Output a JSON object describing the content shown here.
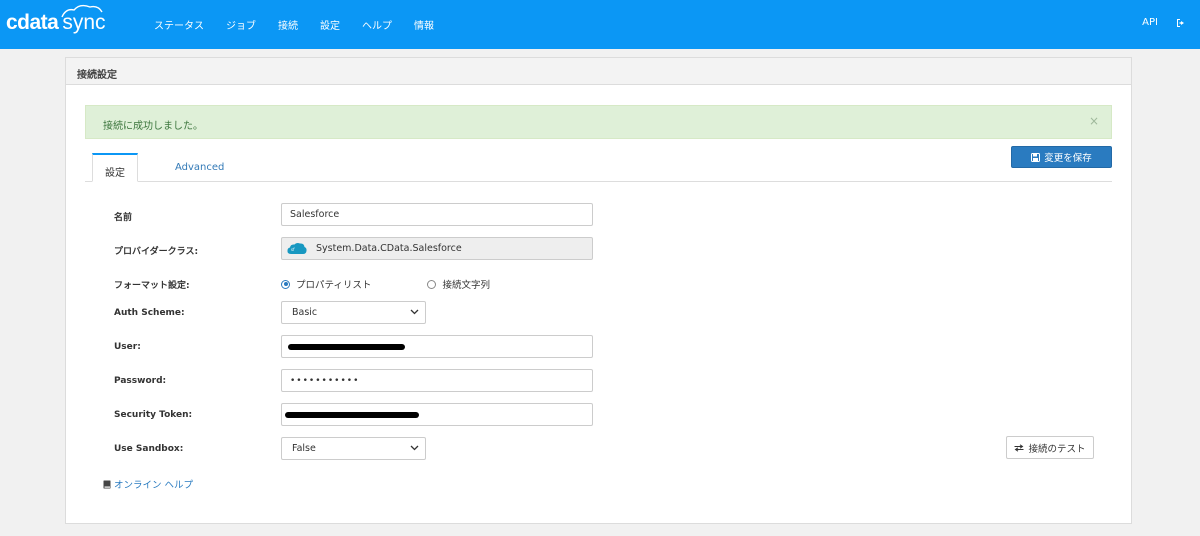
{
  "app": {
    "logo_primary": "cdata",
    "logo_secondary": "sync"
  },
  "nav": {
    "items": [
      "ステータス",
      "ジョブ",
      "接続",
      "設定",
      "ヘルプ",
      "情報"
    ],
    "api_label": "API"
  },
  "panel": {
    "title": "接続設定"
  },
  "alert": {
    "message": "接続に成功しました。",
    "close": "×"
  },
  "toolbar": {
    "save_label": "変更を保存"
  },
  "tabs": [
    {
      "label": "設定",
      "active": true
    },
    {
      "label": "Advanced",
      "active": false
    }
  ],
  "form": {
    "name_label": "名前",
    "name_value": "Salesforce",
    "provider_label": "プロバイダークラス:",
    "provider_value": "System.Data.CData.Salesforce",
    "format_label": "フォーマット設定:",
    "format_options": [
      "プロパティリスト",
      "接続文字列"
    ],
    "format_selected": "プロパティリスト",
    "auth_label": "Auth Scheme:",
    "auth_value": "Basic",
    "user_label": "User:",
    "password_label": "Password:",
    "password_value": "•••••••••••",
    "token_label": "Security Token:",
    "sandbox_label": "Use Sandbox:",
    "sandbox_value": "False"
  },
  "actions": {
    "test_label": "接続のテスト",
    "help_label": "オンライン ヘルプ"
  },
  "colors": {
    "brand": "#0b97f5",
    "primary_button": "#2a7bc0",
    "success_bg": "#dff0d8",
    "success_text": "#3c763d"
  },
  "icons": {
    "save": "floppy-disk-icon",
    "test": "exchange-arrows-icon",
    "help": "book-icon",
    "logout": "logout-icon",
    "provider": "salesforce-cloud-icon"
  }
}
